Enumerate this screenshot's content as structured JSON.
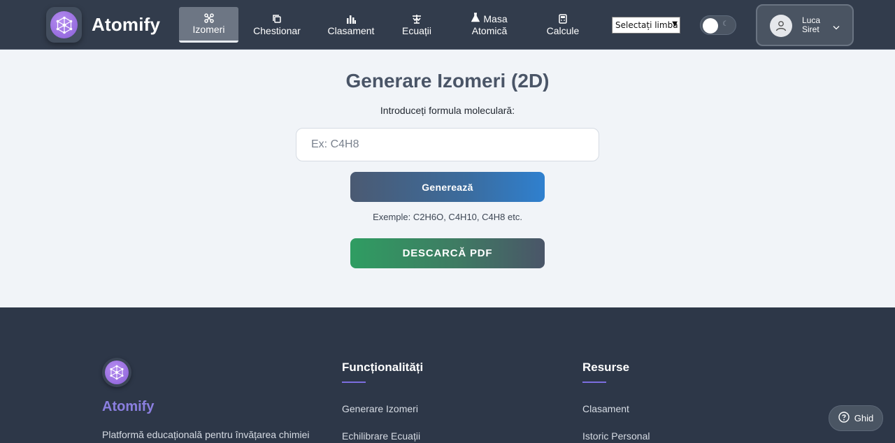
{
  "header": {
    "brand": "Atomify",
    "nav": {
      "izomeri": "Izomeri",
      "chestionar": "Chestionar",
      "clasament": "Clasament",
      "ecuatii": "Ecuații",
      "masa_line1": "Masa",
      "masa_line2": "Atomică",
      "calcule": "Calcule"
    },
    "language_select": "Selectați limba",
    "user": {
      "first_name": "Luca",
      "last_name": "Siret"
    }
  },
  "main": {
    "title": "Generare Izomeri (2D)",
    "formula_label": "Introduceți formula moleculară:",
    "formula_placeholder": "Ex: C4H8",
    "generate_button": "Generează",
    "examples": "Exemple: C2H6O, C4H10, C4H8 etc.",
    "pdf_button": "DESCARCĂ PDF"
  },
  "footer": {
    "brand": "Atomify",
    "description": "Platformă educațională pentru învățarea chimiei",
    "features_title": "Funcționalități",
    "features": [
      "Generare Izomeri",
      "Echilibrare Ecuații"
    ],
    "resources_title": "Resurse",
    "resources": [
      "Clasament",
      "Istoric Personal"
    ]
  },
  "help_button": "Ghid",
  "icons": {
    "logo": "atom-network-icon",
    "izomeri": "molecule-icon",
    "chestionar": "quiz-icon",
    "clasament": "leaderboard-icon",
    "ecuatii": "balance-icon",
    "masa": "flask-icon",
    "calcule": "calculator-icon",
    "theme": "moon-icon",
    "user": "user-icon",
    "help": "question-circle-icon"
  },
  "colors": {
    "navbar": "#323c4c",
    "accent_purple": "#8b7fe0",
    "generate_gradient_end": "#2f80cf",
    "pdf_gradient_start": "#2f9d62",
    "footer": "#2d3748"
  }
}
